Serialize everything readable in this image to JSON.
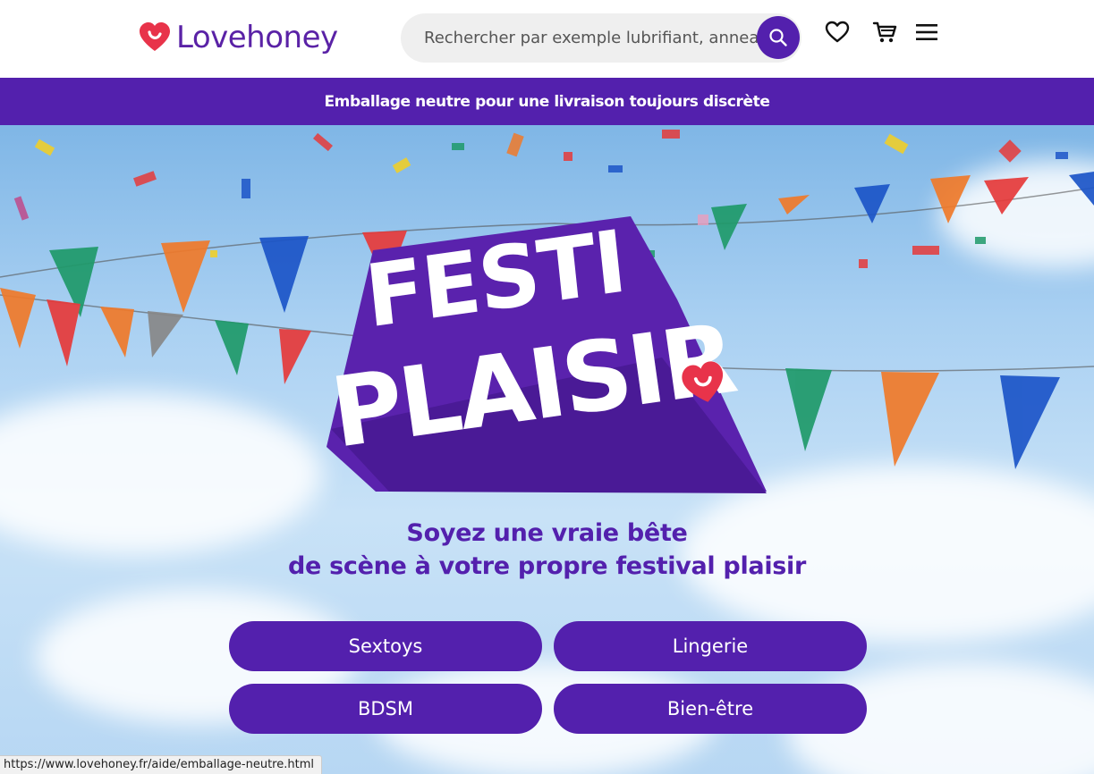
{
  "header": {
    "logo_text": "Lovehoney",
    "search_placeholder": "Rechercher par exemple lubrifiant, anneau",
    "icons": [
      "search-icon",
      "heart-icon",
      "cart-icon",
      "menu-icon"
    ]
  },
  "banner": {
    "text": "Emballage neutre pour une livraison toujours discrète"
  },
  "hero": {
    "title_line1": "FESTI",
    "title_line2": "PLAISIR",
    "tagline_line1": "Soyez une vraie bête",
    "tagline_line2": "de scène à votre propre festival plaisir",
    "buttons": [
      "Sextoys",
      "Lingerie",
      "BDSM",
      "Bien-être"
    ]
  },
  "status_bar": {
    "url": "https://www.lovehoney.fr/aide/emballage-neutre.html"
  },
  "colors": {
    "brand_purple": "#5320ad",
    "heart_red": "#e8334a",
    "sky": "#a9d0f2"
  }
}
